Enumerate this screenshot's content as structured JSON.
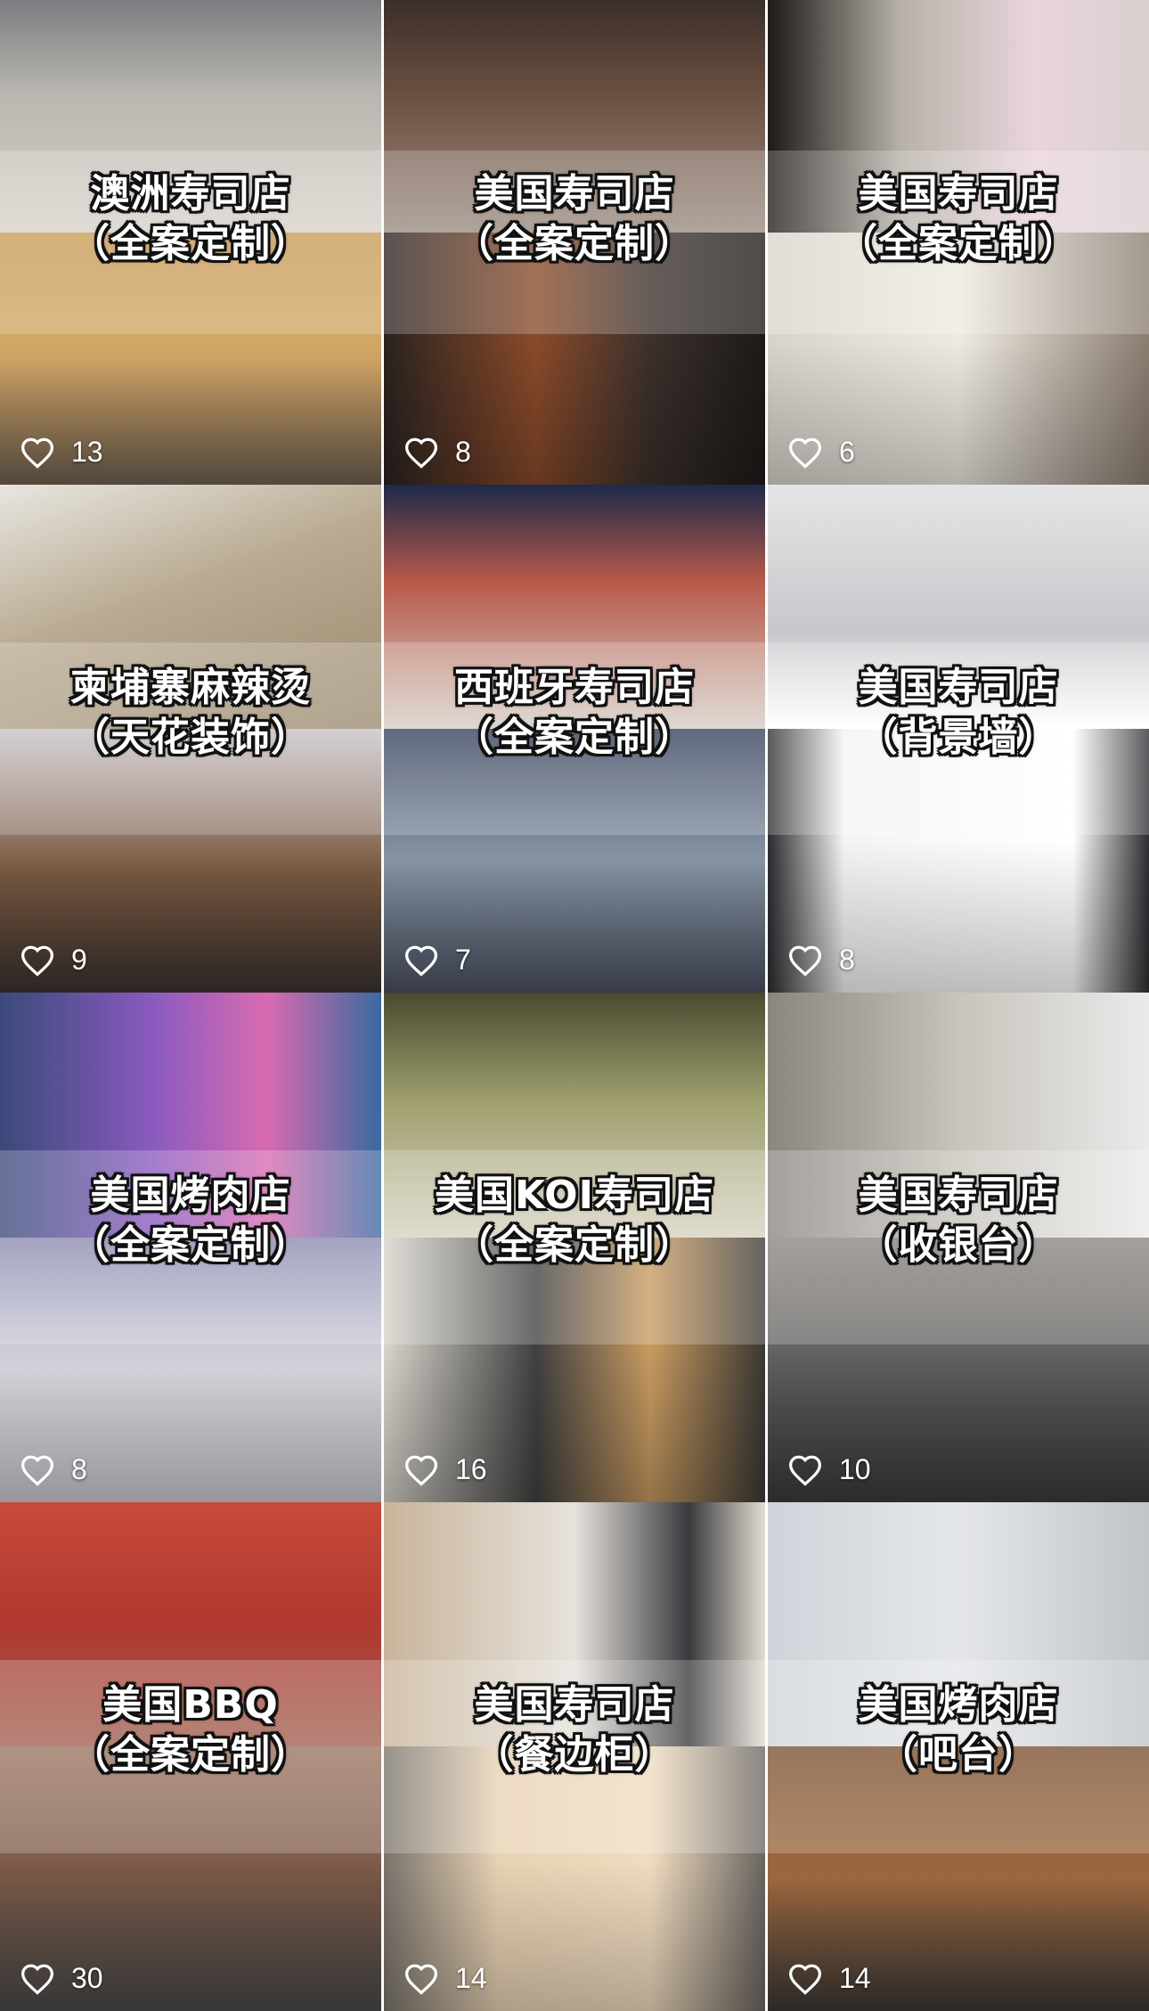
{
  "grid": {
    "tiles": [
      {
        "title": "澳洲寿司店",
        "subtitle": "（全案定制）",
        "likes": "13"
      },
      {
        "title": "美国寿司店",
        "subtitle": "（全案定制）",
        "likes": "8"
      },
      {
        "title": "美国寿司店",
        "subtitle": "（全案定制）",
        "likes": "6"
      },
      {
        "title": "柬埔寨麻辣烫",
        "subtitle": "（天花装饰）",
        "likes": "9"
      },
      {
        "title": "西班牙寿司店",
        "subtitle": "（全案定制）",
        "likes": "7"
      },
      {
        "title": "美国寿司店",
        "subtitle": "（背景墙）",
        "likes": "8"
      },
      {
        "title": "美国烤肉店",
        "subtitle": "（全案定制）",
        "likes": "8"
      },
      {
        "title": "美国KOI寿司店",
        "subtitle": "（全案定制）",
        "likes": "16"
      },
      {
        "title": "美国寿司店",
        "subtitle": "（收银台）",
        "likes": "10"
      },
      {
        "title": "美国BBQ",
        "subtitle": "（全案定制）",
        "likes": "30"
      },
      {
        "title": "美国寿司店",
        "subtitle": "（餐边柜）",
        "likes": "14"
      },
      {
        "title": "美国烤肉店",
        "subtitle": "（吧台）",
        "likes": "14"
      }
    ]
  },
  "icons": {
    "like": "heart-outline-icon"
  },
  "colors": {
    "background": "#ffffff",
    "caption_text": "#ffffff",
    "caption_outline": "#111111"
  }
}
